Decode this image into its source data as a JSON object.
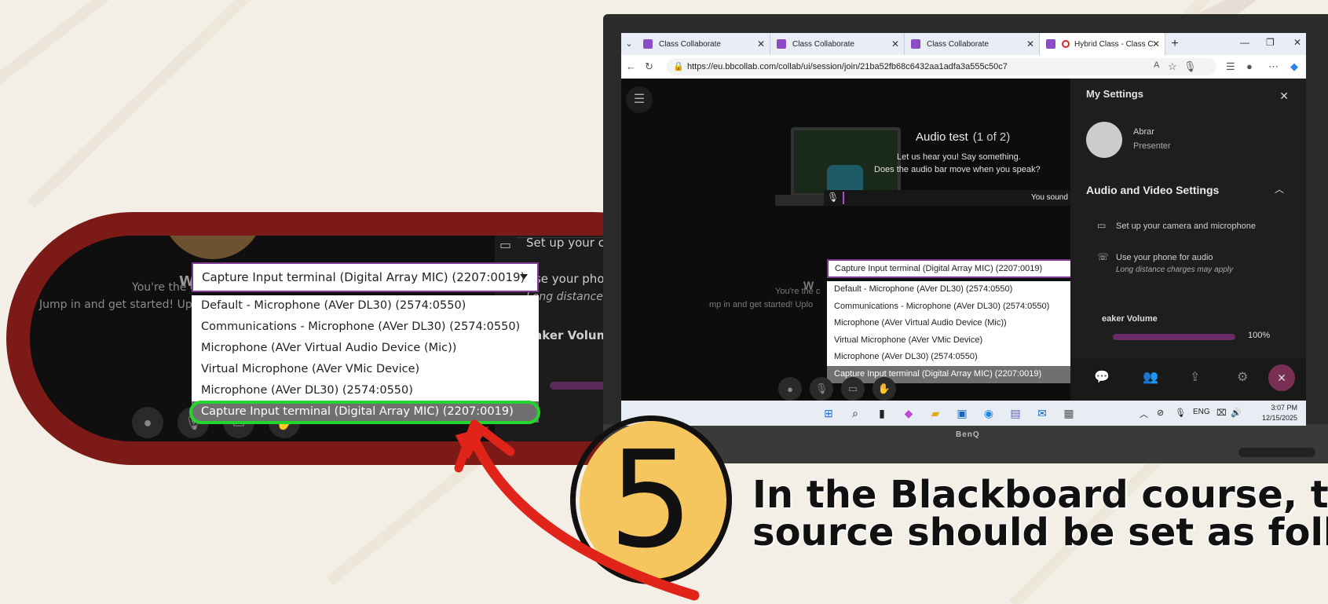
{
  "colors": {
    "background": "#f4efe6",
    "callout_ring": "#7c1a17",
    "highlight": "#22d62e",
    "arrow": "#e0241a",
    "badge": "#f5c65d",
    "accent_purple": "#7c3a90"
  },
  "zoom": {
    "selected_device": "Capture Input terminal (Digital Array MIC) (2207:0019)",
    "options": [
      "Default - Microphone (AVer DL30) (2574:0550)",
      "Communications - Microphone (AVer DL30) (2574:0550)",
      "Microphone (AVer Virtual Audio Device (Mic))",
      "Virtual Microphone (AVer VMic Device)",
      "Microphone (AVer DL30) (2574:0550)",
      "Capture Input terminal (Digital Array MIC) (2207:0019)"
    ],
    "selected_index": 5,
    "bg_text_1": "W",
    "bg_text_2": "You're the c",
    "bg_text_3": "Jump in and get started! Uplo",
    "panel_row_1": "Set up your camera",
    "panel_row_2": "Use your phone for audio",
    "panel_sub_2": "Long distance charges may",
    "panel_vol_label": "eaker Volume"
  },
  "browser": {
    "tabs": [
      {
        "label": "Class Collaborate",
        "active": false
      },
      {
        "label": "Class Collaborate",
        "active": false
      },
      {
        "label": "Class Collaborate",
        "active": false
      },
      {
        "label": "Hybrid Class - Class Co",
        "active": true
      }
    ],
    "url": "https://eu.bbcollab.com/collab/ui/session/join/21ba52fb68c6432aa1adfa3a555c50c7"
  },
  "settings": {
    "title": "My Settings",
    "user_name": "Abrar",
    "user_role": "Presenter",
    "section": "Audio and Video Settings",
    "row_camera": "Set up your camera and microphone",
    "row_phone": "Use your phone for audio",
    "row_phone_sub": "Long distance charges may apply",
    "volume_label": "eaker Volume",
    "volume_value": "100%"
  },
  "audio_test": {
    "title": "Audio test",
    "counter": "(1 of 2)",
    "line1": "Let us hear you! Say something.",
    "line2": "Does the audio bar move when you speak?",
    "status": "You sound great!",
    "selected_device": "Capture Input terminal (Digital Array MIC) (2207:0019)",
    "options": [
      "Default - Microphone (AVer DL30) (2574:0550)",
      "Communications - Microphone (AVer DL30) (2574:0550)",
      "Microphone (AVer Virtual Audio Device (Mic))",
      "Virtual Microphone (AVer VMic Device)",
      "Microphone (AVer DL30) (2574:0550)",
      "Capture Input terminal (Digital Array MIC) (2207:0019)"
    ],
    "bg_text_1": "W",
    "bg_text_2": "You're the c",
    "bg_text_3": "mp in and get started! Uplo"
  },
  "taskbar": {
    "lang": "ENG",
    "time": "3:07 PM",
    "date": "12/15/2025"
  },
  "monitor_brand": "BenQ",
  "step": {
    "number": "5",
    "caption_line1": "In the Blackboard course, the",
    "caption_line2": "source should be set as follow"
  }
}
